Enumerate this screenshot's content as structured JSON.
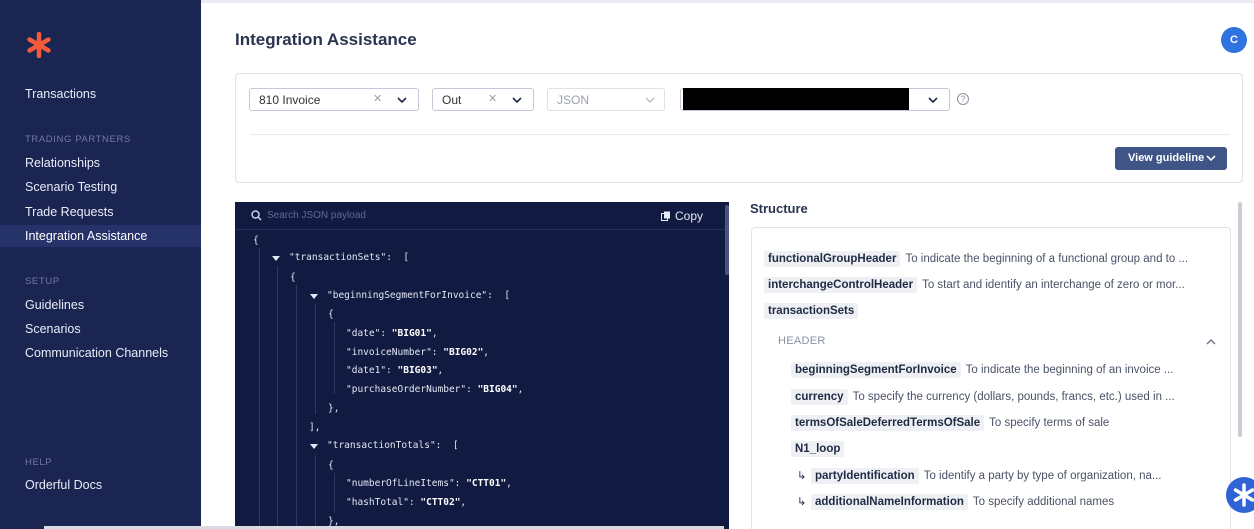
{
  "sidebar": {
    "primary": [
      {
        "label": "Transactions"
      }
    ],
    "sections": [
      {
        "title": "TRADING PARTNERS",
        "items": [
          {
            "label": "Relationships"
          },
          {
            "label": "Scenario Testing"
          },
          {
            "label": "Trade Requests"
          },
          {
            "label": "Integration Assistance",
            "active": true
          }
        ]
      },
      {
        "title": "SETUP",
        "items": [
          {
            "label": "Guidelines"
          },
          {
            "label": "Scenarios"
          },
          {
            "label": "Communication Channels"
          }
        ]
      },
      {
        "title": "HELP",
        "items": [
          {
            "label": "Orderful Docs"
          }
        ]
      }
    ]
  },
  "header": {
    "title": "Integration Assistance",
    "avatar_initial": "C"
  },
  "filters": {
    "transaction_type": "810 Invoice",
    "direction": "Out",
    "format": "JSON",
    "view_guideline_label": "View guideline"
  },
  "json_pane": {
    "search_placeholder": "Search JSON payload",
    "copy_label": "Copy",
    "lines": {
      "l1": "{",
      "l2_key": "\"transactionSets\"",
      "l2_rest": ":  [",
      "l3": "{",
      "l4_key": "\"beginningSegmentForInvoice\"",
      "l4_rest": ":  [",
      "l5": "{",
      "l6_key": "\"date\"",
      "l6_val": "\"BIG01\"",
      "l7_key": "\"invoiceNumber\"",
      "l7_val": "\"BIG02\"",
      "l8_key": "\"date1\"",
      "l8_val": "\"BIG03\"",
      "l9_key": "\"purchaseOrderNumber\"",
      "l9_val": "\"BIG04\"",
      "l10": "},",
      "l11": "],",
      "l12_key": "\"transactionTotals\"",
      "l12_rest": ":  [",
      "l13": "{",
      "l14_key": "\"numberOfLineItems\"",
      "l14_val": "\"CTT01\"",
      "l15_key": "\"hashTotal\"",
      "l15_val": "\"CTT02\"",
      "l16": "},"
    }
  },
  "structure": {
    "title": "Structure",
    "top_level": [
      {
        "name": "functionalGroupHeader",
        "desc": "To indicate the beginning of a functional group and to ..."
      },
      {
        "name": "interchangeControlHeader",
        "desc": "To start and identify an interchange of zero or mor..."
      },
      {
        "name": "transactionSets",
        "desc": ""
      }
    ],
    "section_label": "HEADER",
    "header_items": [
      {
        "name": "beginningSegmentForInvoice",
        "desc": "To indicate the beginning of an invoice ..."
      },
      {
        "name": "currency",
        "desc": "To specify the currency (dollars, pounds, francs, etc.) used in ..."
      },
      {
        "name": "termsOfSaleDeferredTermsOfSale",
        "desc": "To specify terms of sale"
      },
      {
        "name": "N1_loop",
        "desc": ""
      }
    ],
    "loop_children": [
      {
        "name": "partyIdentification",
        "desc": "To identify a party by type of organization, na..."
      },
      {
        "name": "additionalNameInformation",
        "desc": "To specify additional names"
      }
    ]
  },
  "colors": {
    "sidebar_bg": "#1b2552",
    "json_bg": "#111a40",
    "accent": "#2f73e0",
    "button": "#3f5587"
  }
}
